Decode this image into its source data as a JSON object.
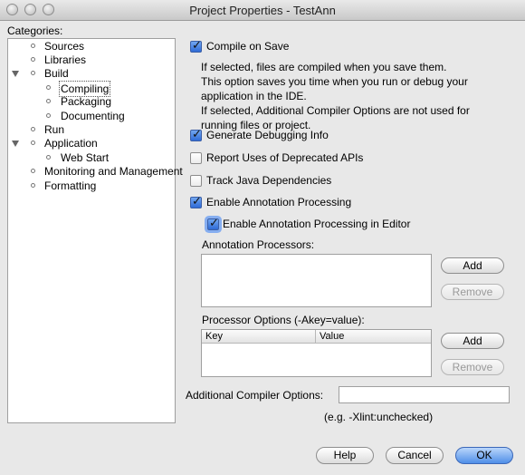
{
  "window": {
    "title": "Project Properties - TestAnn"
  },
  "categories": {
    "label": "Categories:",
    "items": [
      {
        "label": "Sources"
      },
      {
        "label": "Libraries"
      },
      {
        "label": "Build"
      },
      {
        "label": "Compiling",
        "selected": true
      },
      {
        "label": "Packaging"
      },
      {
        "label": "Documenting"
      },
      {
        "label": "Run"
      },
      {
        "label": "Application"
      },
      {
        "label": "Web Start"
      },
      {
        "label": "Monitoring and Management"
      },
      {
        "label": "Formatting"
      }
    ]
  },
  "compile_on_save": {
    "label": "Compile on Save",
    "checked": true,
    "description": [
      "If selected, files are compiled when you save them.",
      "This option saves you time when you run or debug your",
      "application in the IDE.",
      "If selected, Additional Compiler Options are not used for",
      "running files or project."
    ]
  },
  "options": {
    "generate_debugging_info": {
      "label": "Generate Debugging Info",
      "checked": true
    },
    "report_deprecated": {
      "label": "Report Uses of Deprecated APIs",
      "checked": false
    },
    "track_java_dependencies": {
      "label": "Track Java Dependencies",
      "checked": false
    },
    "enable_annotation_processing": {
      "label": "Enable Annotation Processing",
      "checked": true
    },
    "enable_annotation_processing_editor": {
      "label": "Enable Annotation Processing in Editor",
      "checked": true
    }
  },
  "annotation_processors": {
    "label": "Annotation Processors:",
    "add_label": "Add",
    "remove_label": "Remove"
  },
  "processor_options": {
    "label": "Processor Options (-Akey=value):",
    "columns": [
      "Key",
      "Value"
    ],
    "add_label": "Add",
    "remove_label": "Remove"
  },
  "additional_compiler_options": {
    "label": "Additional Compiler Options:",
    "value": "",
    "hint": "(e.g. -Xlint:unchecked)"
  },
  "footer": {
    "help_label": "Help",
    "cancel_label": "Cancel",
    "ok_label": "OK"
  }
}
